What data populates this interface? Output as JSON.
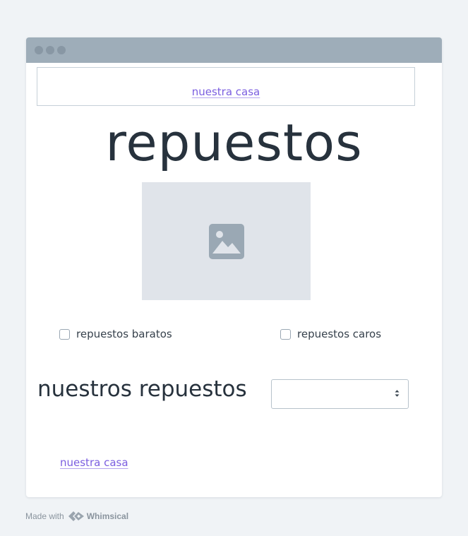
{
  "window": {
    "header_link": "nuestra casa",
    "title": "repuestos",
    "image_icon": "image-placeholder-icon"
  },
  "checkboxes": [
    {
      "label": "repuestos baratos",
      "checked": false
    },
    {
      "label": "repuestos caros",
      "checked": false
    }
  ],
  "section": {
    "title": "nuestros repuestos",
    "select_value": ""
  },
  "footer": {
    "link": "nuestra casa"
  },
  "branding": {
    "made_with": "Made with",
    "brand": "Whimsical"
  },
  "colors": {
    "background": "#f0f3f6",
    "titlebar": "#9eadb9",
    "link": "#7b5ee0",
    "text": "#27323d",
    "placeholder": "#e0e4ea"
  }
}
